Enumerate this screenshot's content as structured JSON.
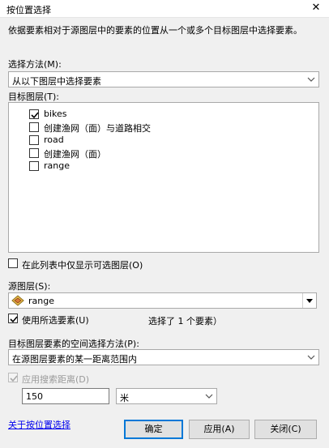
{
  "window": {
    "title": "按位置选择",
    "close_glyph": "✕"
  },
  "description": "依据要素相对于源图层中的要素的位置从一个或多个目标图层中选择要素。",
  "selection_method": {
    "label": "选择方法(M):",
    "value": "从以下图层中选择要素"
  },
  "target_layers": {
    "label": "目标图层(T):",
    "items": [
      {
        "label": "bikes",
        "checked": true
      },
      {
        "label": "创建渔网（面）与道路相交",
        "checked": false
      },
      {
        "label": "road",
        "checked": false
      },
      {
        "label": "创建渔网（面）",
        "checked": false
      },
      {
        "label": "range",
        "checked": false
      }
    ]
  },
  "only_selectable": {
    "label": "在此列表中仅显示可选图层(O)",
    "checked": false
  },
  "source_layer": {
    "label": "源图层(S):",
    "value": "range",
    "icon": "polygon-layer-icon"
  },
  "use_selected": {
    "label": "使用所选要素(U)",
    "checked": true,
    "status": "选择了 1 个要素）"
  },
  "spatial_method": {
    "label": "目标图层要素的空间选择方法(P):",
    "value": "在源图层要素的某一距离范围内"
  },
  "search_distance": {
    "label": "应用搜索距离(D)",
    "checked": true,
    "enabled": false,
    "value": "150",
    "unit": "米"
  },
  "footer": {
    "help_link": "关于按位置选择",
    "ok": "确定",
    "apply": "应用(A)",
    "close": "关闭(C)"
  },
  "colors": {
    "accent": "#0078d7",
    "link": "#0000ee",
    "dialog_bg": "#f0f0f0"
  }
}
